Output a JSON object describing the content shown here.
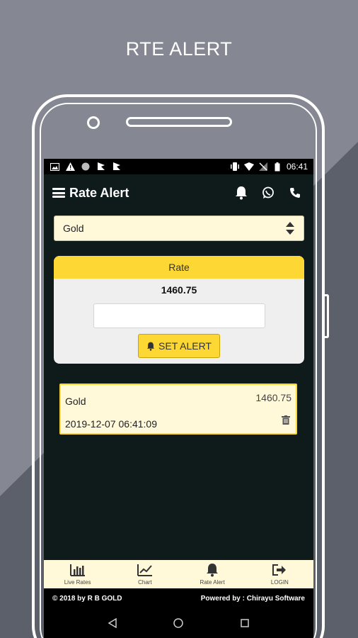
{
  "promo": {
    "title": "RTE ALERT"
  },
  "status_bar": {
    "time": "06:41",
    "left_icons": [
      "image-icon",
      "warning-icon",
      "circle-icon",
      "flag-icon",
      "flag-icon"
    ],
    "right_icons": [
      "vibrate-icon",
      "wifi-icon",
      "signal-icon",
      "battery-icon"
    ]
  },
  "app_bar": {
    "title": "Rate Alert",
    "actions": [
      "bell-icon",
      "whatsapp-icon",
      "phone-icon"
    ]
  },
  "select": {
    "value": "Gold"
  },
  "rate_card": {
    "header": "Rate",
    "rate": "1460.75",
    "input_value": "",
    "button_label": "SET ALERT"
  },
  "alerts": [
    {
      "name": "Gold",
      "rate": "1460.75",
      "datetime": "2019-12-07 06:41:09"
    }
  ],
  "bottom_nav": [
    {
      "label": "Live Rates",
      "icon": "bar-chart-icon"
    },
    {
      "label": "Chart",
      "icon": "line-chart-icon"
    },
    {
      "label": "Rate Alert",
      "icon": "bell-icon"
    },
    {
      "label": "LOGIN",
      "icon": "login-icon"
    }
  ],
  "footer": {
    "left": "© 2018 by R B GOLD",
    "right": "Powered by : Chirayu Software"
  },
  "colors": {
    "accent": "#fdd835",
    "card_bg": "#fff8d9",
    "screen_bg": "#0f1a1b"
  }
}
